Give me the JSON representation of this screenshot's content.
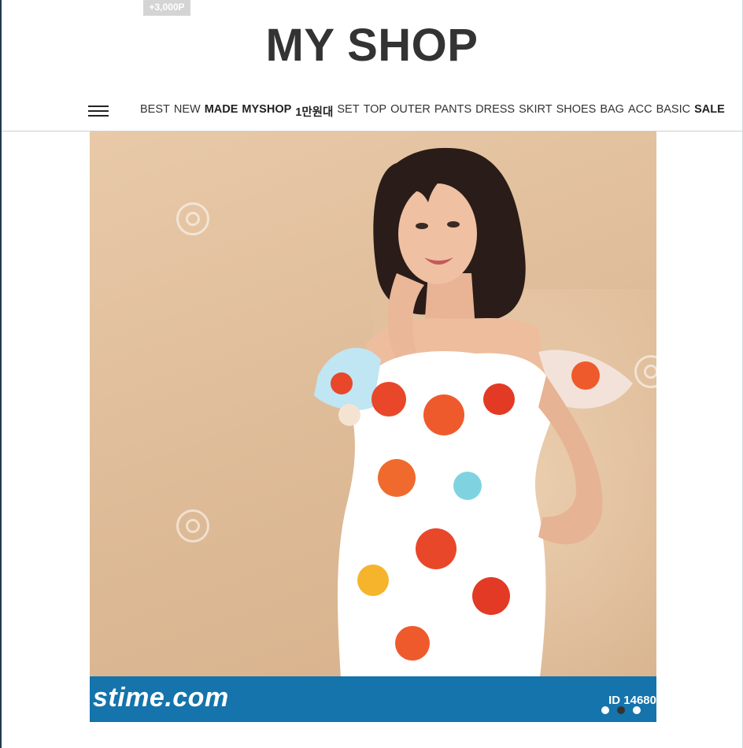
{
  "header": {
    "points_badge": "+3,000P",
    "logo": "MY SHOP"
  },
  "nav": {
    "menu_icon": "hamburger-icon",
    "items": [
      {
        "label": "BEST",
        "bold": false
      },
      {
        "label": "NEW",
        "bold": false
      },
      {
        "label": "MADE",
        "bold": true
      },
      {
        "label": "MYSHOP",
        "bold": true
      },
      {
        "label": "1만원대",
        "bold": true
      },
      {
        "label": "SET",
        "bold": false
      },
      {
        "label": "TOP",
        "bold": false
      },
      {
        "label": "OUTER",
        "bold": false
      },
      {
        "label": "PANTS",
        "bold": false
      },
      {
        "label": "DRESS",
        "bold": false
      },
      {
        "label": "SKIRT",
        "bold": false
      },
      {
        "label": "SHOES",
        "bold": false
      },
      {
        "label": "BAG",
        "bold": false
      },
      {
        "label": "ACC",
        "bold": false
      },
      {
        "label": "BASIC",
        "bold": false
      },
      {
        "label": "SALE",
        "bold": true
      }
    ]
  },
  "banner": {
    "watermark_text": "stime.com",
    "watermark_id": "ID 14680",
    "slide_count": 3,
    "active_slide": 2
  },
  "colors": {
    "logo": "#333333",
    "badge_bg": "#d4d4d4",
    "watermark_strip": "#1474ab",
    "backdrop": "#dcb894"
  }
}
